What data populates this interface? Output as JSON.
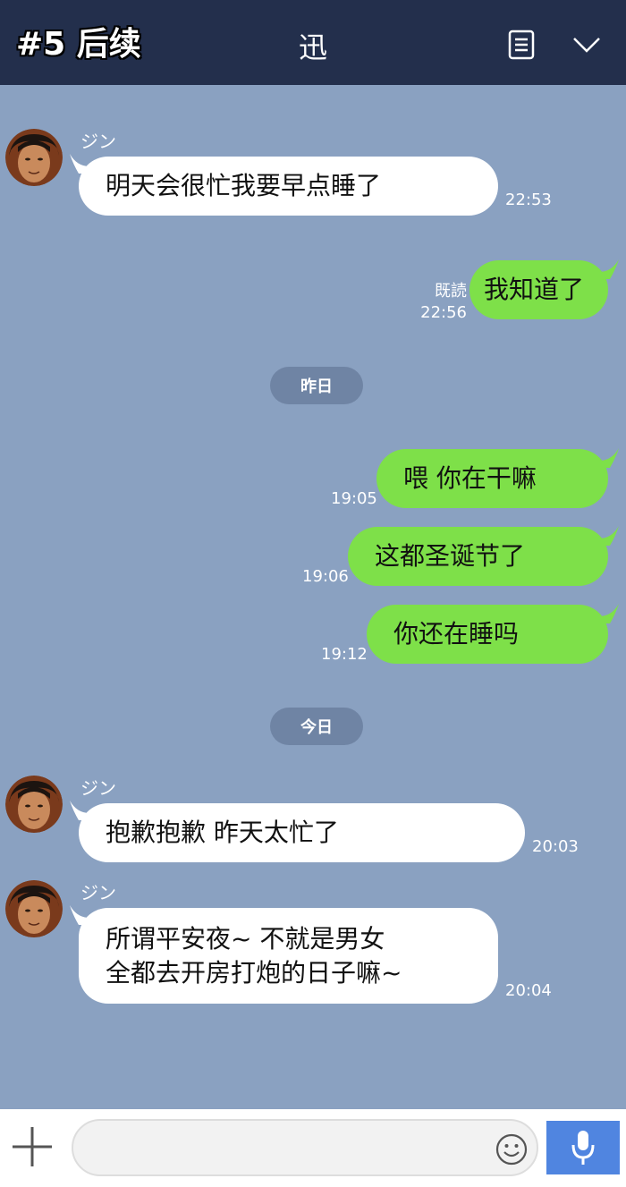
{
  "header": {
    "badge": "#5 后续",
    "title": "迅"
  },
  "messages": [
    {
      "sender": "ジン",
      "text": "明天会很忙我要早点睡了",
      "time": "22:53"
    },
    {
      "read": "既読",
      "text": "我知道了",
      "time": "22:56"
    },
    {
      "date": "昨日"
    },
    {
      "text": "喂 你在干嘛",
      "time": "19:05"
    },
    {
      "text": "这都圣诞节了",
      "time": "19:06"
    },
    {
      "text": "你还在睡吗",
      "time": "19:12"
    },
    {
      "date": "今日"
    },
    {
      "sender": "ジン",
      "text": "抱歉抱歉 昨天太忙了",
      "time": "20:03"
    },
    {
      "sender": "ジン",
      "lines": [
        "所谓平安夜~ 不就是男女",
        "全都去开房打炮的日子嘛~"
      ],
      "time": "20:04"
    }
  ],
  "input": {
    "value": "",
    "placeholder": ""
  },
  "icons": {
    "note": "note-icon",
    "chevron": "chevron-down-icon",
    "plus": "plus-icon",
    "emoji": "emoji-icon",
    "mic": "microphone-icon"
  },
  "colors": {
    "header": "#232f4c",
    "background": "#8aa1c1",
    "sent_bubble": "#7ee049",
    "received_bubble": "#ffffff",
    "date_pill": "#6f84a4",
    "mic_button": "#5085e0"
  }
}
